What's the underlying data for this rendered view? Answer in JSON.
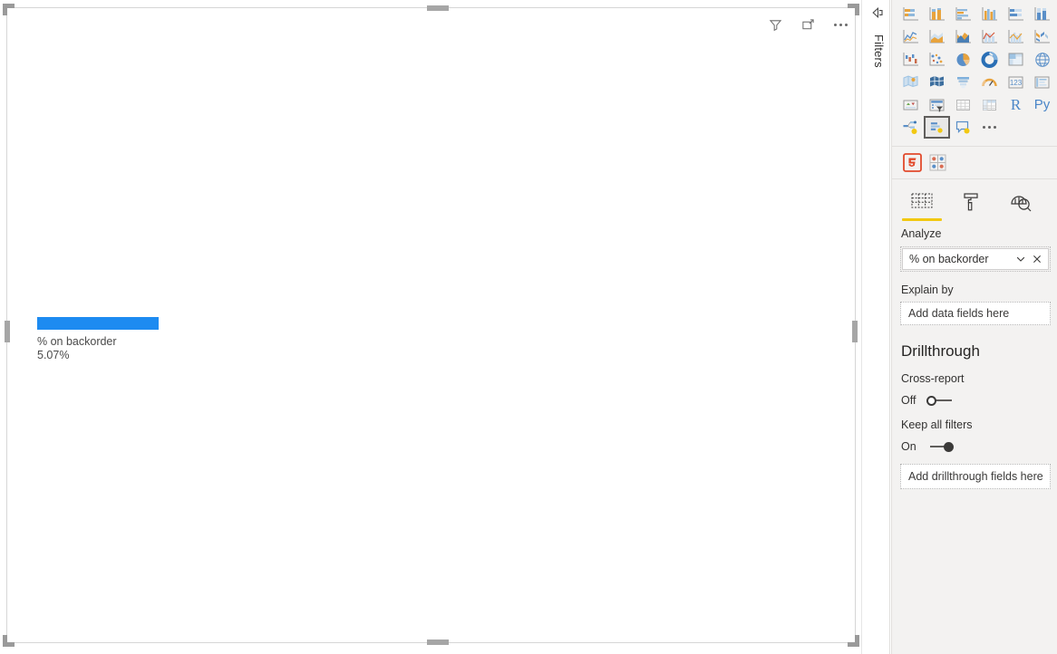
{
  "canvas": {
    "visual": {
      "header_icons": [
        {
          "name": "filter-icon",
          "label": "Filters"
        },
        {
          "name": "focus-mode-icon",
          "label": "Focus mode"
        },
        {
          "name": "more-options-icon",
          "label": "More options"
        }
      ],
      "chart_data": {
        "type": "bar",
        "title": "",
        "categories": [
          "% on backorder"
        ],
        "values": [
          5.07
        ],
        "value_labels": [
          "5.07%"
        ],
        "series": [
          {
            "name": "% on backorder",
            "values": [
              5.07
            ]
          }
        ],
        "bar_color": "#1d8bf1",
        "xlabel": "",
        "ylabel": "",
        "grid": false,
        "legend": "none",
        "note": "Key influencers visual - single top segment bar"
      }
    }
  },
  "filters_rail": {
    "expand_icon": "expand-filters-icon",
    "label": "Filters"
  },
  "right_pane": {
    "visualizations": {
      "rows": [
        [
          {
            "name": "stacked-bar-chart-icon",
            "label": "Stacked bar chart"
          },
          {
            "name": "stacked-column-chart-icon",
            "label": "Stacked column chart"
          },
          {
            "name": "clustered-bar-chart-icon",
            "label": "Clustered bar chart"
          },
          {
            "name": "clustered-column-chart-icon",
            "label": "Clustered column chart"
          },
          {
            "name": "hundred-percent-stacked-bar-chart-icon",
            "label": "100% stacked bar chart"
          },
          {
            "name": "hundred-percent-stacked-column-chart-icon",
            "label": "100% stacked column chart"
          }
        ],
        [
          {
            "name": "line-chart-icon",
            "label": "Line chart"
          },
          {
            "name": "area-chart-icon",
            "label": "Area chart"
          },
          {
            "name": "stacked-area-chart-icon",
            "label": "Stacked area chart"
          },
          {
            "name": "line-and-stacked-column-chart-icon",
            "label": "Line and stacked column chart"
          },
          {
            "name": "line-and-clustered-column-chart-icon",
            "label": "Line and clustered column chart"
          },
          {
            "name": "ribbon-chart-icon",
            "label": "Ribbon chart"
          }
        ],
        [
          {
            "name": "waterfall-chart-icon",
            "label": "Waterfall chart"
          },
          {
            "name": "scatter-chart-icon",
            "label": "Scatter chart"
          },
          {
            "name": "pie-chart-icon",
            "label": "Pie chart"
          },
          {
            "name": "donut-chart-icon",
            "label": "Donut chart"
          },
          {
            "name": "treemap-icon",
            "label": "Treemap"
          },
          {
            "name": "map-icon",
            "label": "Map"
          }
        ],
        [
          {
            "name": "filled-map-icon",
            "label": "Filled map"
          },
          {
            "name": "shape-map-icon",
            "label": "Shape map"
          },
          {
            "name": "funnel-chart-icon",
            "label": "Funnel"
          },
          {
            "name": "gauge-chart-icon",
            "label": "Gauge"
          },
          {
            "name": "card-icon",
            "label": "Card"
          },
          {
            "name": "multi-row-card-icon",
            "label": "Multi-row card"
          }
        ],
        [
          {
            "name": "kpi-icon",
            "label": "KPI"
          },
          {
            "name": "slicer-icon",
            "label": "Slicer"
          },
          {
            "name": "table-icon",
            "label": "Table"
          },
          {
            "name": "matrix-icon",
            "label": "Matrix"
          },
          {
            "name": "r-script-visual-icon",
            "label": "R"
          },
          {
            "name": "python-visual-icon",
            "label": "Py"
          }
        ],
        [
          {
            "name": "decomposition-tree-icon",
            "label": "Decomposition tree"
          },
          {
            "name": "key-influencers-icon",
            "label": "Key influencers",
            "selected": true
          },
          {
            "name": "qna-visual-icon",
            "label": "Q&A"
          },
          {
            "name": "more-visuals-icon",
            "label": "More options"
          }
        ]
      ],
      "r_label": "R",
      "py_label": "Py"
    },
    "custom_visuals": [
      {
        "name": "html-content-visual-icon",
        "label": "HTML"
      },
      {
        "name": "custom-visual-icon",
        "label": "Custom visual"
      }
    ],
    "tabs": [
      {
        "name": "tab-fields",
        "label": "Analyze",
        "icon": "fields-table-icon",
        "active": true
      },
      {
        "name": "tab-format",
        "label": "Format",
        "icon": "paint-roller-icon",
        "active": false
      },
      {
        "name": "tab-analytics",
        "label": "Analytics",
        "icon": "analytics-magnifier-icon",
        "active": false
      }
    ],
    "active_tab_caption": "Analyze",
    "analyze_field": {
      "value": "% on backorder",
      "chevron_icon": "chevron-down-icon",
      "remove_icon": "close-icon"
    },
    "explain_by": {
      "label": "Explain by",
      "dropzone_placeholder": "Add data fields here"
    },
    "drillthrough": {
      "heading": "Drillthrough",
      "cross_report": {
        "label": "Cross-report",
        "state_text": "Off",
        "state": "off"
      },
      "keep_all_filters": {
        "label": "Keep all filters",
        "state_text": "On",
        "state": "on"
      },
      "dropzone_placeholder": "Add drillthrough fields here"
    }
  },
  "colors": {
    "accent_blue": "#1d8bf1",
    "pane_bg": "#f3f2f1",
    "tab_underline": "#f2c811",
    "icon_orange": "#e8a33d",
    "icon_blue": "#5a8fc8"
  }
}
